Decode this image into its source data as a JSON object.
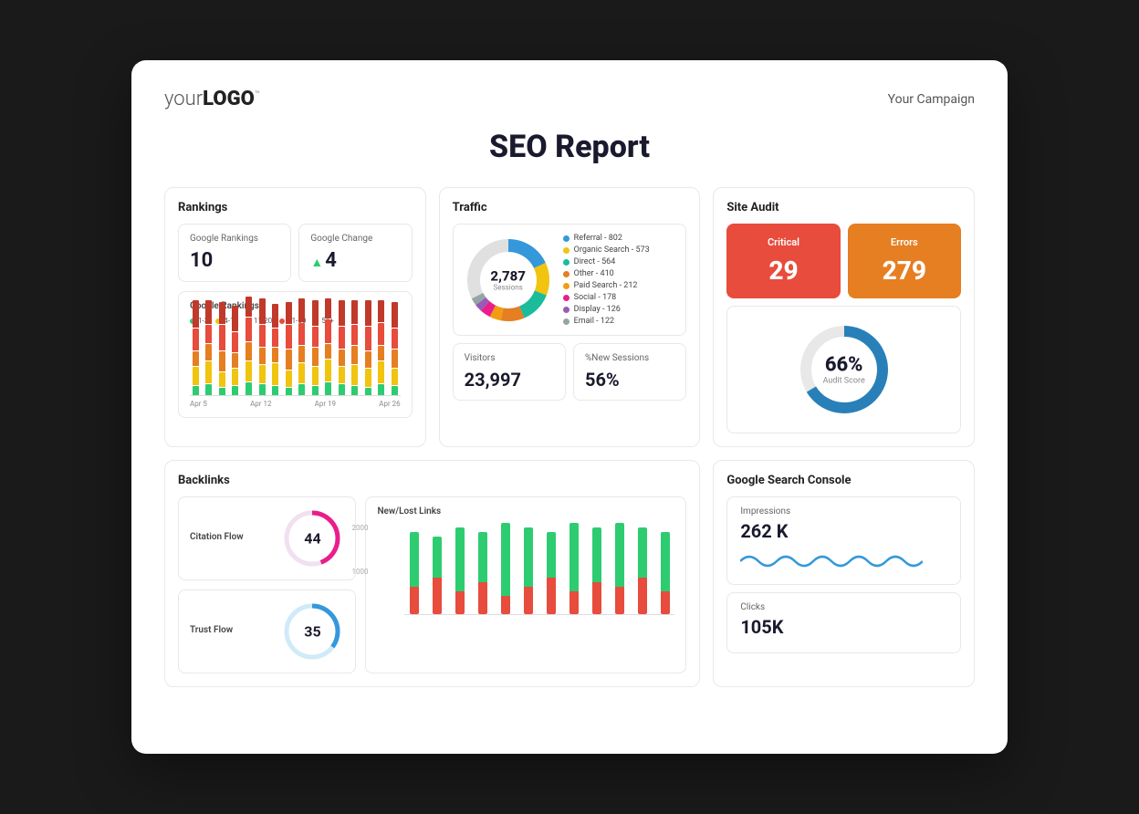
{
  "header": {
    "logo_text": "your",
    "logo_bold": "LOGO",
    "logo_tm": "™",
    "campaign_label": "Your Campaign",
    "report_title": "SEO Report"
  },
  "rankings": {
    "title": "Rankings",
    "google_rankings_label": "Google Rankings",
    "google_rankings_value": "10",
    "google_change_label": "Google Change",
    "google_change_value": "4",
    "bar_chart_title": "Google Rankings",
    "legend": [
      {
        "label": "1-3",
        "color": "#2ecc71"
      },
      {
        "label": "4-10",
        "color": "#f1c40f"
      },
      {
        "label": "11-20",
        "color": "#e67e22"
      },
      {
        "label": "21-50",
        "color": "#e74c3c"
      },
      {
        "label": "51+",
        "color": "#c0392b"
      }
    ],
    "axis_labels": [
      "Apr 5",
      "Apr 12",
      "Apr 19",
      "Apr 26"
    ]
  },
  "traffic": {
    "title": "Traffic",
    "sessions_value": "2,787",
    "sessions_label": "Sessions",
    "legend": [
      {
        "label": "Referral - 802",
        "color": "#3498db"
      },
      {
        "label": "Organic Search - 573",
        "color": "#f1c40f"
      },
      {
        "label": "Direct - 564",
        "color": "#1abc9c"
      },
      {
        "label": "Other - 410",
        "color": "#e67e22"
      },
      {
        "label": "Paid Search - 212",
        "color": "#f39c12"
      },
      {
        "label": "Social - 178",
        "color": "#e91e8c"
      },
      {
        "label": "Display - 126",
        "color": "#9b59b6"
      },
      {
        "label": "Email - 122",
        "color": "#34495e"
      }
    ],
    "visitors_label": "Visitors",
    "visitors_value": "23,997",
    "new_sessions_label": "%New Sessions",
    "new_sessions_value": "56%"
  },
  "site_audit": {
    "title": "Site Audit",
    "critical_label": "Critical",
    "critical_value": "29",
    "errors_label": "Errors",
    "errors_value": "279",
    "score_pct": "66%",
    "score_label": "Audit Score"
  },
  "backlinks": {
    "title": "Backlinks",
    "citation_flow_label": "Citation Flow",
    "citation_flow_value": "44",
    "trust_flow_label": "Trust Flow",
    "trust_flow_value": "35",
    "new_lost_label": "New/Lost Links",
    "y_labels": [
      "2000",
      "1000"
    ]
  },
  "gsc": {
    "title": "Google Search Console",
    "impressions_label": "Impressions",
    "impressions_value": "262 K",
    "clicks_label": "Clicks",
    "clicks_value": "105K"
  }
}
